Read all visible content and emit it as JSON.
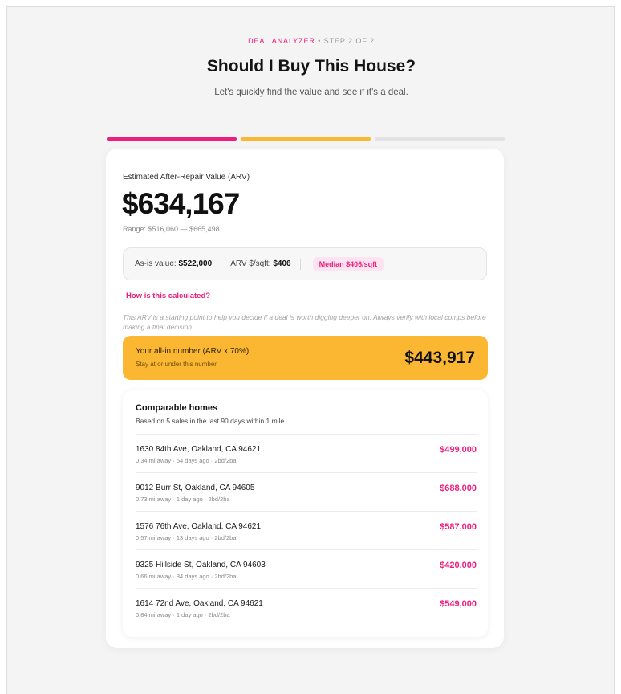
{
  "header": {
    "eyebrow_accent": "DEAL ANALYZER",
    "eyebrow_sep": "•",
    "eyebrow_step": "STEP 2 OF 2",
    "title": "Should I Buy This House?",
    "subtitle": "Let's quickly find the value and see if it's a deal."
  },
  "progress": {
    "steps": 3,
    "colors": [
      "#ec1e7e",
      "#fbb732",
      "#e3e3e3"
    ]
  },
  "arv": {
    "label": "Estimated After-Repair Value (ARV)",
    "value": "$634,167",
    "range": "Range: $516,060 — $665,498"
  },
  "stats": {
    "as_is_label": "As-is value:",
    "as_is_value": "$522,000",
    "arv_sqft_label": "ARV $/sqft:",
    "arv_sqft_value": "$406",
    "median_badge": "Median $406/sqft"
  },
  "how_link": "How is this calculated?",
  "disclaimer": "This ARV is a starting point to help you decide if a deal is worth digging deeper on. Always verify with local comps before making a final decision.",
  "all_in": {
    "label": "Your all-in number (ARV x 70%)",
    "sub": "Stay at or under this number",
    "value": "$443,917"
  },
  "comps": {
    "title": "Comparable homes",
    "subtitle": "Based on 5 sales in the last 90 days within 1 mile",
    "items": [
      {
        "address": "1630 84th Ave, Oakland, CA 94621",
        "meta": "0.34 mi away · 54 days ago · 2bd/2ba",
        "price": "$499,000"
      },
      {
        "address": "9012 Burr St, Oakland, CA 94605",
        "meta": "0.73 mi away · 1 day ago · 2bd/2ba",
        "price": "$688,000"
      },
      {
        "address": "1576 76th Ave, Oakland, CA 94621",
        "meta": "0.57 mi away · 13 days ago · 2bd/2ba",
        "price": "$587,000"
      },
      {
        "address": "9325 Hillside St, Oakland, CA 94603",
        "meta": "0.66 mi away · 84 days ago · 2bd/2ba",
        "price": "$420,000"
      },
      {
        "address": "1614 72nd Ave, Oakland, CA 94621",
        "meta": "0.84 mi away · 1 day ago · 2bd/2ba",
        "price": "$549,000"
      }
    ]
  },
  "colors": {
    "accent_pink": "#ec1e7e",
    "accent_yellow": "#fbb732",
    "background": "#f4f4f4"
  }
}
